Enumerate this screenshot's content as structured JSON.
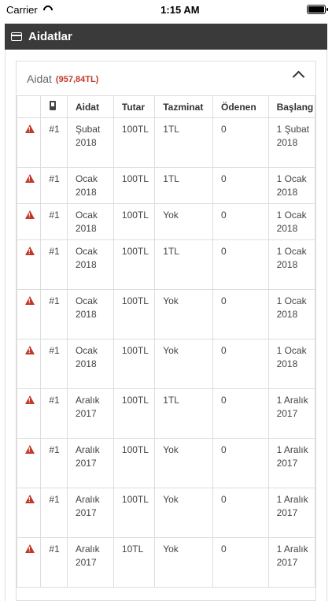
{
  "status": {
    "carrier": "Carrier",
    "time": "1:15 AM"
  },
  "header": {
    "title": "Aidatlar"
  },
  "panel": {
    "title": "Aidat",
    "amount": "(957,84TL)"
  },
  "table": {
    "columns": [
      "",
      "",
      "Aidat",
      "Tutar",
      "Tazminat",
      "Ödenen",
      "Başlang"
    ],
    "rows": [
      {
        "no": "#1",
        "aidat": "Şubat 2018",
        "tutar": "100TL",
        "tazminat": "1TL",
        "odenen": "0",
        "baslangic": "1 Şubat 2018"
      },
      {
        "no": "#1",
        "aidat": "Ocak 2018",
        "tutar": "100TL",
        "tazminat": "1TL",
        "odenen": "0",
        "baslangic": "1 Ocak 2018"
      },
      {
        "no": "#1",
        "aidat": "Ocak 2018",
        "tutar": "100TL",
        "tazminat": "Yok",
        "odenen": "0",
        "baslangic": "1 Ocak 2018"
      },
      {
        "no": "#1",
        "aidat": "Ocak 2018",
        "tutar": "100TL",
        "tazminat": "1TL",
        "odenen": "0",
        "baslangic": "1 Ocak 2018"
      },
      {
        "no": "#1",
        "aidat": "Ocak 2018",
        "tutar": "100TL",
        "tazminat": "Yok",
        "odenen": "0",
        "baslangic": "1 Ocak 2018"
      },
      {
        "no": "#1",
        "aidat": "Ocak 2018",
        "tutar": "100TL",
        "tazminat": "Yok",
        "odenen": "0",
        "baslangic": "1 Ocak 2018"
      },
      {
        "no": "#1",
        "aidat": "Aralık 2017",
        "tutar": "100TL",
        "tazminat": "1TL",
        "odenen": "0",
        "baslangic": "1 Aralık 2017"
      },
      {
        "no": "#1",
        "aidat": "Aralık 2017",
        "tutar": "100TL",
        "tazminat": "Yok",
        "odenen": "0",
        "baslangic": "1 Aralık 2017"
      },
      {
        "no": "#1",
        "aidat": "Aralık 2017",
        "tutar": "100TL",
        "tazminat": "Yok",
        "odenen": "0",
        "baslangic": "1 Aralık 2017"
      },
      {
        "no": "#1",
        "aidat": "Aralık 2017",
        "tutar": "10TL",
        "tazminat": "Yok",
        "odenen": "0",
        "baslangic": "1 Aralık 2017"
      }
    ]
  },
  "icons": {
    "row_status": "warning-icon",
    "phone_column": "phone-icon",
    "collapse": "chevron-up-icon",
    "header": "credit-card-icon"
  },
  "colors": {
    "header_bg": "#3a3a3a",
    "warning": "#c0392b",
    "amount": "#c0392b"
  }
}
